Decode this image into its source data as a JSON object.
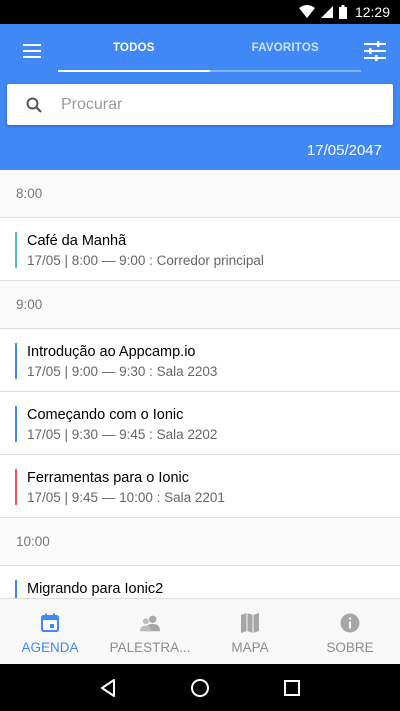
{
  "status": {
    "time": "12:29"
  },
  "header": {
    "tabs": [
      {
        "label": "TODOS",
        "active": true
      },
      {
        "label": "FAVORITOS",
        "active": false
      }
    ],
    "search": {
      "placeholder": "Procurar",
      "value": ""
    },
    "date": "17/05/2047"
  },
  "schedule": [
    {
      "time": "8:00",
      "sessions": [
        {
          "title": "Café da Manhã",
          "meta": "17/05 | 8:00 — 9:00 : Corredor principal",
          "color": "#4fc1b5"
        }
      ]
    },
    {
      "time": "9:00",
      "sessions": [
        {
          "title": "Introdução ao Appcamp.io",
          "meta": "17/05 | 9:00 — 9:30 : Sala 2203",
          "color": "#3f88f6"
        },
        {
          "title": "Começando com o Ionic",
          "meta": "17/05 | 9:30 — 9:45 : Sala 2202",
          "color": "#3f88f6"
        },
        {
          "title": "Ferramentas para o Ionic",
          "meta": "17/05 | 9:45 — 10:00 : Sala 2201",
          "color": "#f25454"
        }
      ]
    },
    {
      "time": "10:00",
      "sessions": [
        {
          "title": "Migrando para Ionic2",
          "meta": "",
          "color": "#3f88f6"
        }
      ]
    }
  ],
  "bottom_tabs": [
    {
      "label": "AGENDA",
      "icon": "calendar-icon",
      "active": true
    },
    {
      "label": "PALESTRA...",
      "icon": "people-icon",
      "active": false
    },
    {
      "label": "MAPA",
      "icon": "map-icon",
      "active": false
    },
    {
      "label": "SOBRE",
      "icon": "info-icon",
      "active": false
    }
  ],
  "colors": {
    "primary": "#3f88f6",
    "inactive": "#8c8c8c"
  }
}
